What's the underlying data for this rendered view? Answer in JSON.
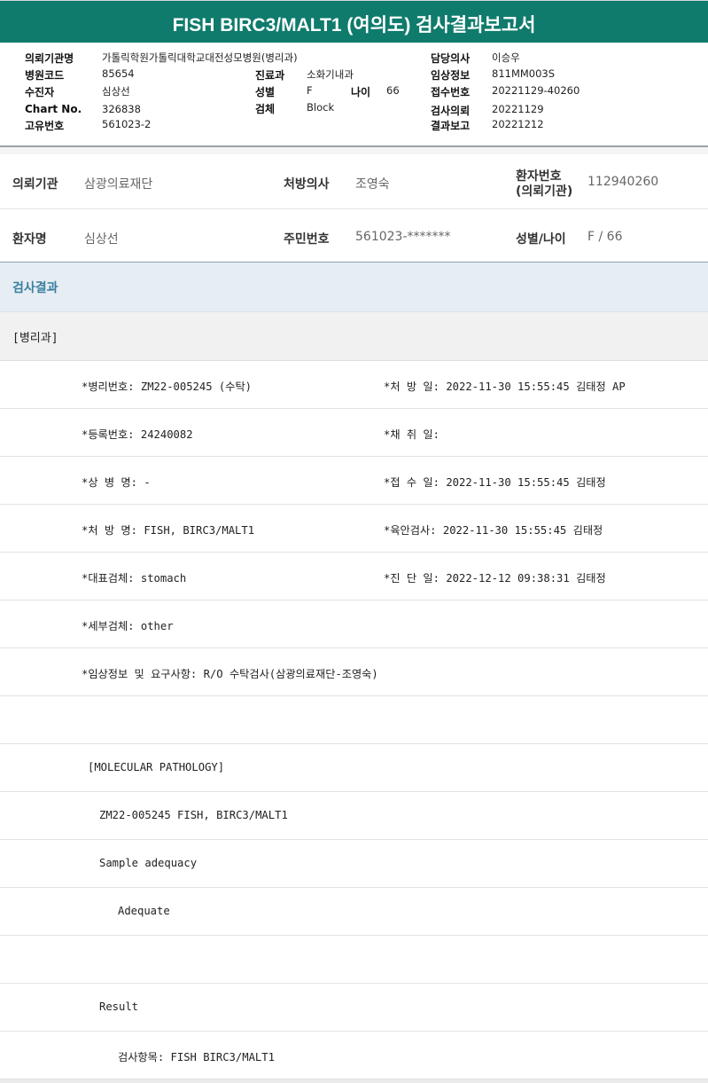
{
  "title": "FISH BIRC3/MALT1 (여의도) 검사결과보고서",
  "info": {
    "left": [
      {
        "key": "의뢰기관명",
        "value": "가톨릭학원가톨릭대학교대전성모병원(병리과)"
      },
      {
        "key": "병원코드",
        "value": "85654"
      },
      {
        "key": "수진자",
        "value": "심상선"
      },
      {
        "key": "Chart No.",
        "value": "326838"
      },
      {
        "key": "고유번호",
        "value": "561023-2"
      }
    ],
    "middle": [
      {
        "key": "진료과",
        "value": "소화기내과"
      },
      {
        "key": "성별",
        "value": "F"
      },
      {
        "key": "검체",
        "value": "Block"
      }
    ],
    "age": {
      "key": "나이",
      "value": "66"
    },
    "right": [
      {
        "key": "담당의사",
        "value": "이승우"
      },
      {
        "key": "임상정보",
        "value": "811MM003S"
      },
      {
        "key": "접수번호",
        "value": "20221129-40260"
      },
      {
        "key": "검사의뢰",
        "value": "20221129"
      },
      {
        "key": "결과보고",
        "value": "20221212"
      }
    ]
  },
  "patient": {
    "institution_label": "의뢰기관",
    "institution": "삼광의료재단",
    "doctor_label": "처방의사",
    "doctor": "조영숙",
    "patient_no_label_1": "환자번호",
    "patient_no_label_2": "(의뢰기관)",
    "patient_no": "112940260",
    "name_label": "환자명",
    "name": "심상선",
    "rrn_label": "주민번호",
    "rrn": "561023-*******",
    "sexage_label": "성별/나이",
    "sexage": "F / 66"
  },
  "result_header": "검사결과",
  "department": "[병리과]",
  "lines": [
    {
      "left": "*병리번호: ZM22-005245 (수탁)",
      "right": "*처 방 일: 2022-11-30 15:55:45  김태정 AP"
    },
    {
      "left": "*등록번호: 24240082",
      "right": "*채 취 일:"
    },
    {
      "left": "*상 병 명: -",
      "right": "*접 수 일: 2022-11-30 15:55:45  김태정"
    },
    {
      "left": "*처 방 명: FISH, BIRC3/MALT1",
      "right": "*육안검사: 2022-11-30 15:55:45  김태정"
    },
    {
      "left": "*대표검체: stomach",
      "right": "*진 단 일: 2022-12-12 09:38:31  김태정"
    },
    {
      "left": "*세부검체: other",
      "right": ""
    },
    {
      "left": "*임상정보 및 요구사항: R/O 수탁검사(삼광의료재단-조영숙)",
      "right": ""
    },
    {
      "left": "",
      "right": ""
    },
    {
      "left": "[MOLECULAR PATHOLOGY]",
      "right": ""
    },
    {
      "left": "ZM22-005245     FISH, BIRC3/MALT1",
      "right": ""
    },
    {
      "left": "Sample adequacy",
      "right": ""
    },
    {
      "left": "Adequate",
      "right": ""
    },
    {
      "left": "",
      "right": ""
    },
    {
      "left": "Result",
      "right": ""
    },
    {
      "left": "검사항목: FISH BIRC3/MALT1",
      "right": ""
    }
  ]
}
